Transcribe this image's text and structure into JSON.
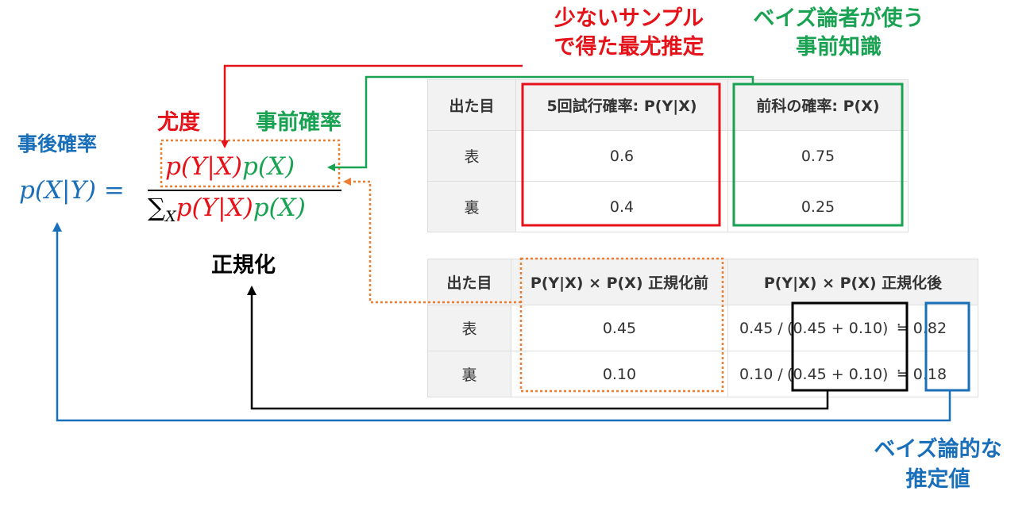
{
  "labels": {
    "mle_line1": "少ないサンプル",
    "mle_line2": "で得た最尤推定",
    "bayes_prior_line1": "ベイズ論者が使う",
    "bayes_prior_line2": "事前知識",
    "likelihood": "尤度",
    "prior": "事前確率",
    "posterior": "事後確率",
    "normalization": "正規化",
    "bayes_est_line1": "ベイズ論的な",
    "bayes_est_line2": "推定値"
  },
  "formula": {
    "lhs": "p(X|Y) =",
    "num_likelihood": "p(Y|X)",
    "num_prior": "p(X)",
    "den_sum": "∑",
    "den_sub": "X",
    "den_likelihood": "p(Y|X)",
    "den_prior": "p(X)"
  },
  "table1": {
    "headers": [
      "出た目",
      "5回試行確率: P(Y|X)",
      "前科の確率: P(X)"
    ],
    "rows": [
      [
        "表",
        "0.6",
        "0.75"
      ],
      [
        "裏",
        "0.4",
        "0.25"
      ]
    ]
  },
  "table2": {
    "headers": [
      "出た目",
      "P(Y|X) × P(X) 正規化前",
      "P(Y|X) × P(X) 正規化後"
    ],
    "rows": [
      {
        "label": "表",
        "pre": "0.45",
        "num": "0.45 /",
        "den": "(0.45 + 0.10)",
        "approx": "≒",
        "result": "0.82"
      },
      {
        "label": "裏",
        "pre": "0.10",
        "num": "0.10 /",
        "den": "(0.45 + 0.10)",
        "approx": "≒",
        "result": "0.18"
      }
    ]
  },
  "colors": {
    "likelihood": "#e6121a",
    "prior": "#1aa253",
    "posterior": "#1a6fba",
    "normalization": "#000000",
    "unnormalized": "#ed7d31"
  }
}
